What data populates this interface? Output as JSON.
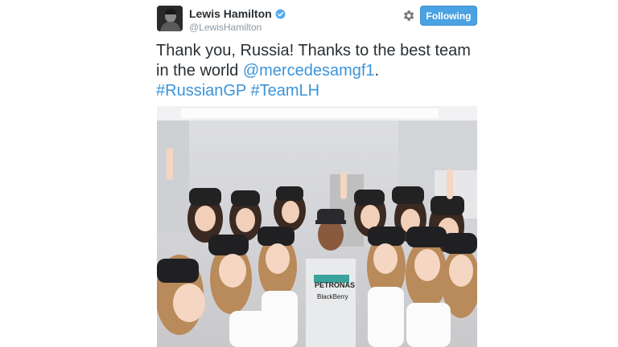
{
  "author": {
    "name": "Lewis Hamilton",
    "handle": "@LewisHamilton",
    "verified_icon": "verified-badge-icon",
    "avatar_icon": "avatar"
  },
  "actions": {
    "settings_icon": "gear-icon",
    "follow_label": "Following"
  },
  "tweet": {
    "line1": "Thank you, Russia! Thanks to the best team",
    "line2_prefix": "in the world ",
    "mention": "@mercedesamgf1",
    "line2_suffix": ".",
    "hashtag1": "#RussianGP",
    "hashtag2": "#TeamLH"
  },
  "photo": {
    "shirt_text_1": "PETRONAS",
    "shirt_text_2": "BlackBerry"
  },
  "colors": {
    "link": "#3b94d9",
    "button": "#4ba2e2",
    "text": "#292f33",
    "muted": "#8899a6"
  }
}
